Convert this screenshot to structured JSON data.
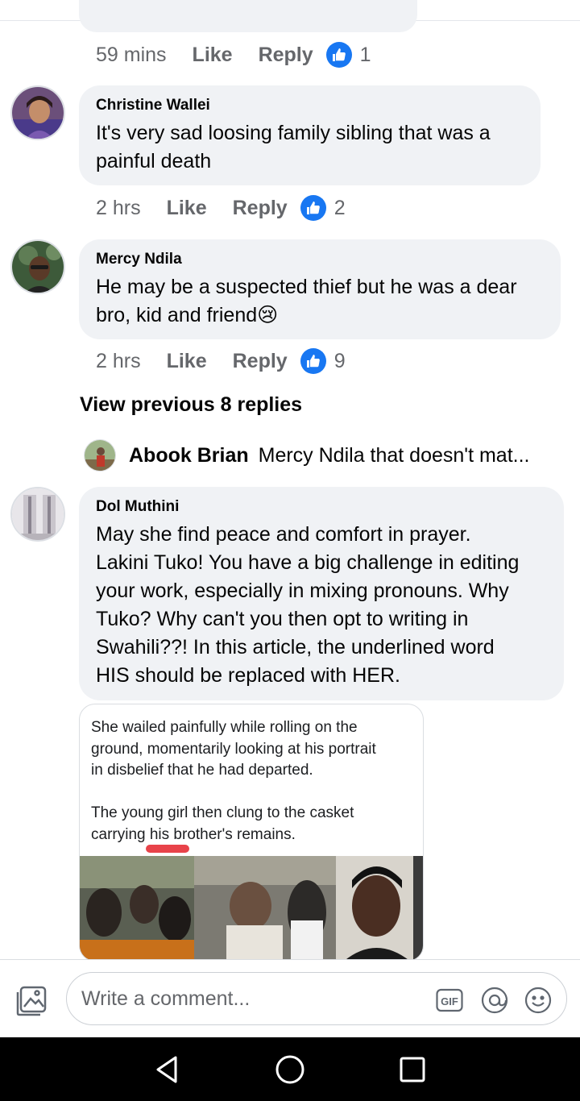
{
  "previous_comment": {
    "time": "59 mins",
    "like_label": "Like",
    "reply_label": "Reply",
    "reactions": "1"
  },
  "comments": [
    {
      "name": "Christine Wallei",
      "text": "It's very sad loosing family sibling that was a\npainful death",
      "time": "2 hrs",
      "like_label": "Like",
      "reply_label": "Reply",
      "reactions": "2"
    },
    {
      "name": "Mercy Ndila",
      "text": "He may be a suspected thief but he was a dear\nbro, kid and friend",
      "emoji": "😢",
      "time": "2 hrs",
      "like_label": "Like",
      "reply_label": "Reply",
      "reactions": "9"
    },
    {
      "name": "Dol Muthini",
      "text": "May she find peace and comfort in prayer.\nLakini Tuko! You have a big challenge in editing\nyour work, especially in mixing pronouns. Why\nTuko? Why can't you then opt to writing in\nSwahili??! In this article, the underlined word\nHIS should be replaced with HER."
    }
  ],
  "view_previous_replies": "View previous 8 replies",
  "reply_preview": {
    "name": "Abook Brian",
    "text": "Mercy Ndila that doesn't mat..."
  },
  "attached_image": {
    "caption": "She wailed painfully while rolling on the\nground, momentarily looking at his portrait\nin disbelief that he had departed.\n\nThe young girl then clung to the casket\ncarrying his brother's remains."
  },
  "composer": {
    "placeholder": "Write a comment...",
    "gif_label": "GIF",
    "icons": [
      "gallery-icon",
      "gif-icon",
      "mention-icon",
      "emoji-icon"
    ]
  },
  "nav_bar": {
    "icons": [
      "back-icon",
      "home-icon",
      "recents-icon"
    ]
  },
  "colors": {
    "like_blue": "#1877f2",
    "bubble_bg": "#f0f2f5",
    "meta_gray": "#65676b",
    "underline_red": "#e8434a"
  }
}
